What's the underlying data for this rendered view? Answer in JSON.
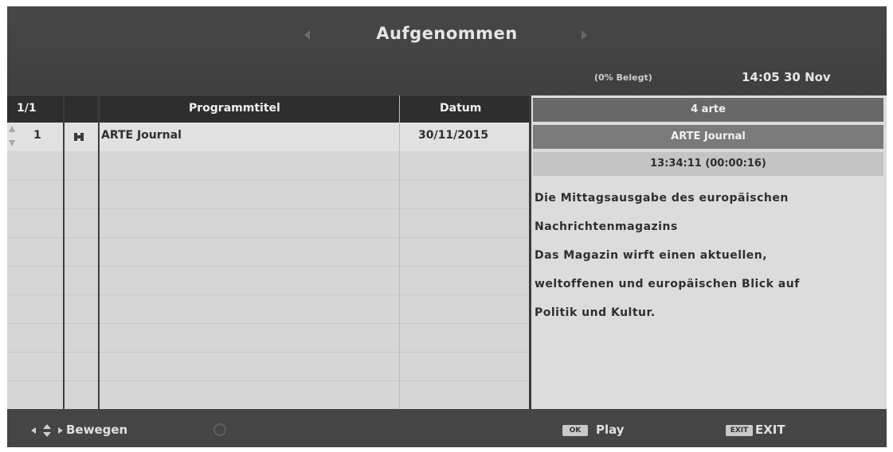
{
  "header": {
    "title": "Aufgenommen",
    "usage": "(0% Belegt)",
    "clock": "14:05 30 Nov"
  },
  "table": {
    "page_indicator": "1/1",
    "columns": {
      "title": "Programmtitel",
      "date": "Datum"
    },
    "rows": [
      {
        "number": "1",
        "icon": "recording-icon",
        "title": "ARTE Journal",
        "date": "30/11/2015"
      }
    ]
  },
  "detail": {
    "channel": "4 arte",
    "program_title": "ARTE Journal",
    "time": "13:34:11 (00:00:16)",
    "description_lines": [
      "Die Mittagsausgabe des europäischen",
      "Nachrichtenmagazins",
      "Das Magazin wirft einen aktuellen,",
      "weltoffenen und europäischen Blick auf",
      "Politik und Kultur."
    ]
  },
  "footer": {
    "move_label": "Bewegen",
    "ok_key": "OK",
    "play_label": "Play",
    "exit_key": "EXIT",
    "exit_label": "EXIT"
  }
}
